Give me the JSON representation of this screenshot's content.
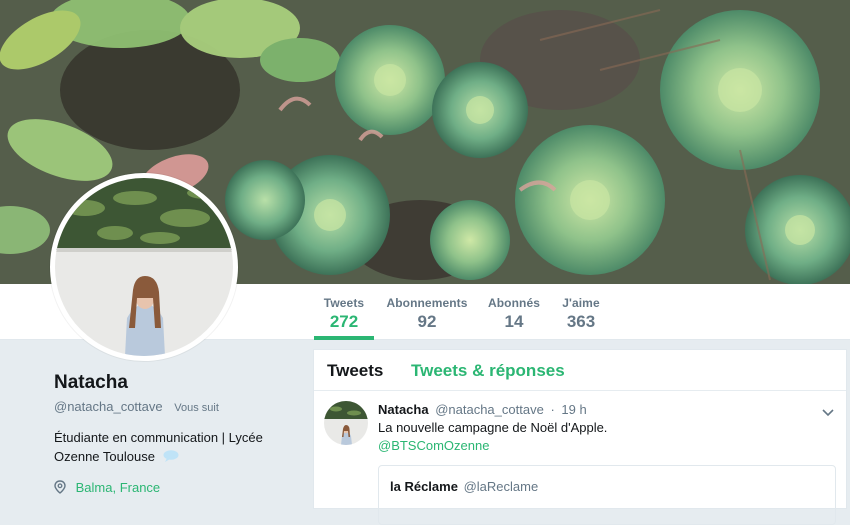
{
  "profile": {
    "name": "Natacha",
    "handle": "@natacha_cottave",
    "follows_you": "Vous suit",
    "bio": "Étudiante en communication | Lycée Ozenne Toulouse",
    "location": "Balma, France"
  },
  "nav": {
    "stats": [
      {
        "label": "Tweets",
        "value": "272",
        "active": true
      },
      {
        "label": "Abonnements",
        "value": "92"
      },
      {
        "label": "Abonnés",
        "value": "14"
      },
      {
        "label": "J'aime",
        "value": "363"
      }
    ]
  },
  "timeline": {
    "tabs": [
      "Tweets",
      "Tweets & réponses"
    ],
    "tweet": {
      "name": "Natacha",
      "handle": "@natacha_cottave",
      "separator": "·",
      "time": "19 h",
      "text": "La nouvelle campagne de Noël d'Apple.",
      "mention": "@BTSComOzenne",
      "quote": {
        "name": "la Réclame",
        "handle": "@laReclame"
      }
    }
  },
  "colors": {
    "accent": "#2bb673",
    "background": "#e6ecf0",
    "muted_text": "#657786"
  },
  "icons": [
    "chevron-down-icon",
    "location-pin-icon",
    "speech-bubble-icon"
  ]
}
